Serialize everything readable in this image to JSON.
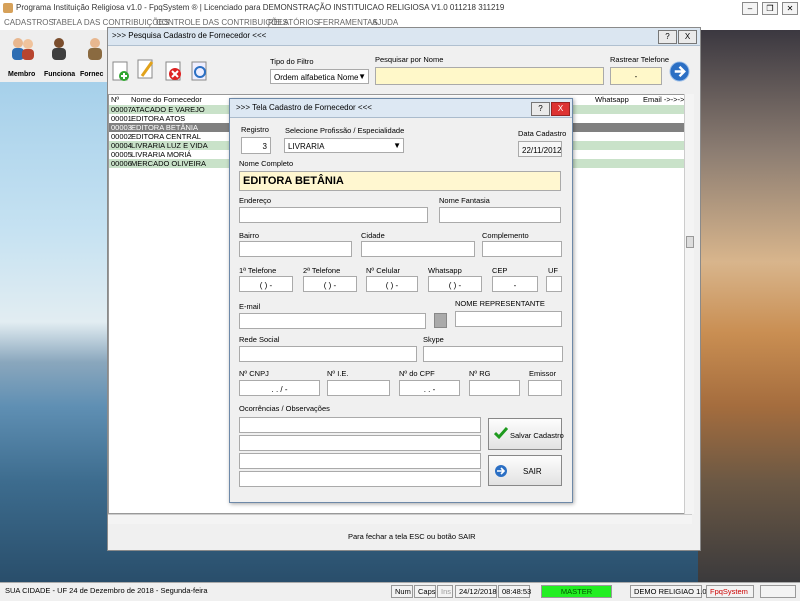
{
  "app": {
    "title": "Programa Instituição Religiosa v1.0 - FpqSystem ® | Licenciado para  DEMONSTRAÇÃO INSTITUICAO RELIGIOSA V1.0 011218 311219"
  },
  "menu": [
    "CADASTROS",
    "TABELA DAS CONTRIBUIÇÕES",
    "CONTROLE DAS CONTRIBUIÇÕES",
    "RELATÓRIOS",
    "FERRAMENTAS",
    "AJUDA"
  ],
  "toolbar": {
    "items": [
      "Membro",
      "Funciona",
      "Fornec"
    ]
  },
  "search_window": {
    "title": ">>> Pesquisa Cadastro de Fornecedor <<<",
    "help_label": "?",
    "close_label": "X",
    "filter_label": "Tipo do Filtro",
    "filter_value": "Ordem alfabetica Nome",
    "search_label": "Pesquisar por Nome",
    "search_value": "",
    "phone_label": "Rastrear Telefone",
    "phone_value": "-",
    "go_icon": "arrow-right-icon",
    "columns": [
      "Nº",
      "Nome do Fornecedor",
      "Whatsapp",
      "Email ->->->"
    ],
    "rows": [
      {
        "num": "00007",
        "name": "ATACADO E VAREJO"
      },
      {
        "num": "00001",
        "name": "EDITORA ATOS"
      },
      {
        "num": "00003",
        "name": "EDITORA BETÂNIA"
      },
      {
        "num": "00002",
        "name": "EDITORA CENTRAL"
      },
      {
        "num": "00004",
        "name": "LIVRARIA LUZ E VIDA"
      },
      {
        "num": "00005",
        "name": "LIVRARIA MORIÁ"
      },
      {
        "num": "00006",
        "name": "MERCADO OLIVEIRA"
      }
    ],
    "footer_hint": "Para fechar a tela ESC ou botão SAIR"
  },
  "dialog": {
    "title": ">>> Tela Cadastro de Fornecedor <<<",
    "help_label": "?",
    "close_label": "X",
    "registro_label": "Registro",
    "registro_value": "3",
    "profissao_label": "Selecione Profissão / Especialidade",
    "profissao_value": "LIVRARIA",
    "data_label": "Data Cadastro",
    "data_value": "22/11/2012",
    "nome_label": "Nome Completo",
    "nome_value": "EDITORA BETÂNIA",
    "endereco_label": "Endereço",
    "fantasia_label": "Nome Fantasia",
    "bairro_label": "Bairro",
    "cidade_label": "Cidade",
    "complemento_label": "Complemento",
    "tel1_label": "1ª Telefone",
    "tel1_value": "(  )    -",
    "tel2_label": "2ª Telefone",
    "tel2_value": "(  )    -",
    "cel_label": "Nº Celular",
    "cel_value": "(  )    -",
    "whats_label": "Whatsapp",
    "whats_value": "(  )    -",
    "cep_label": "CEP",
    "cep_value": "-",
    "uf_label": "UF",
    "email_label": "E-mail",
    "representante_label": "NOME REPRESENTANTE",
    "rede_label": "Rede Social",
    "skype_label": "Skype",
    "cnpj_label": "Nº CNPJ",
    "cnpj_value": ".   .   /   -",
    "ie_label": "Nº I.E.",
    "cpf_label": "Nº do CPF",
    "cpf_value": ".   .   -",
    "rg_label": "Nº RG",
    "emissor_label": "Emissor",
    "obs_label": "Ocorrências / Observações",
    "save_label": "Salvar Cadastro",
    "exit_label": "SAIR"
  },
  "status": {
    "city": "SUA CIDADE - UF 24 de Dezembro de 2018 - Segunda-feira",
    "num": "Num",
    "caps": "Caps",
    "ins": "Ins",
    "date": "24/12/2018",
    "time": "08:48:53",
    "mode": "MASTER",
    "version": "DEMO RELIGIAO 1.0",
    "brand": "FpqSystem"
  },
  "colors": {
    "selected_row": "#808080",
    "highlight_row": "#c9e2c9",
    "master_green": "#22ee22",
    "brand_red": "#cc0000",
    "name_field": "#fff7d0"
  }
}
